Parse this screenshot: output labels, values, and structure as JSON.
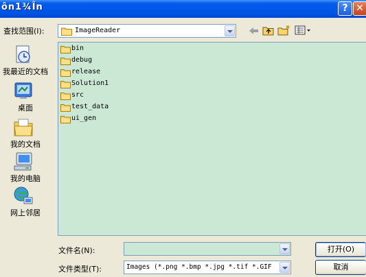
{
  "window": {
    "title": "ôn1¾În",
    "help_label": "?",
    "close_label": "✕"
  },
  "lookin": {
    "label": "查找范围(I):",
    "value": "ImageReader"
  },
  "toolbar": {
    "back_icon": "back-arrow-icon",
    "up_icon": "up-folder-icon",
    "new_folder_icon": "new-folder-icon",
    "view_menu_icon": "view-menu-icon"
  },
  "places": [
    {
      "label": "我最近的文档",
      "icon": "recent-documents-icon"
    },
    {
      "label": "桌面",
      "icon": "desktop-icon"
    },
    {
      "label": "我的文档",
      "icon": "my-documents-icon"
    },
    {
      "label": "我的电脑",
      "icon": "my-computer-icon"
    },
    {
      "label": "网上邻居",
      "icon": "network-places-icon"
    }
  ],
  "files": [
    "bin",
    "debug",
    "release",
    "Solution1",
    "src",
    "test_data",
    "ui_gen"
  ],
  "filename": {
    "label": "文件名(N):",
    "value": ""
  },
  "filetype": {
    "label": "文件类型(T):",
    "value": "Images (*.png *.bmp *.jpg *.tif *.GIF"
  },
  "buttons": {
    "open": "打开(O)",
    "cancel": "取消"
  },
  "colors": {
    "titlebar": "#0054e3",
    "list_bg": "#cbe8d5",
    "dialog_bg": "#ece9d8"
  }
}
